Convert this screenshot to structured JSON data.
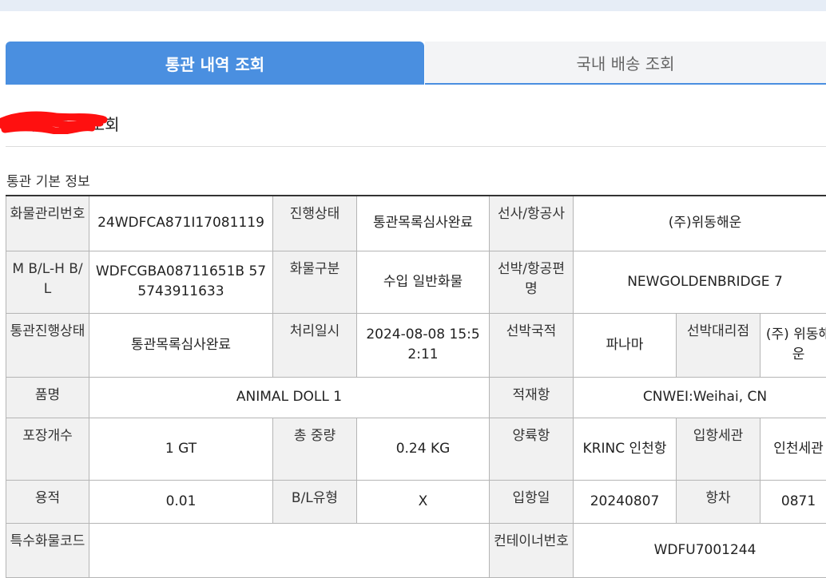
{
  "tabs": {
    "active": "통관 내역 조회",
    "inactive": "국내 배송 조회"
  },
  "title": {
    "name": "고객님",
    "suffix": " 통관 조회"
  },
  "section_title": "통관 기본 정보",
  "table": {
    "r1": {
      "h1": "화물관리번호",
      "v1": "24WDFCA871I17081119",
      "h2": "진행상태",
      "v2": "통관목록심사완료",
      "h3": "선사/항공사",
      "v3": "(주)위동해운"
    },
    "r2": {
      "h1": "M B/L-H B/L",
      "v1": "WDFCGBA08711651B 575743911633",
      "h2": "화물구분",
      "v2": "수입 일반화물",
      "h3": "선박/항공편명",
      "v3": "NEWGOLDENBRIDGE 7"
    },
    "r3": {
      "h1": "통관진행상태",
      "v1": "통관목록심사완료",
      "h2": "처리일시",
      "v2": "2024-08-08 15:52:11",
      "h3": "선박국적",
      "v3": "파나마",
      "h4": "선박대리점",
      "v4": "(주) 위동해운"
    },
    "r4": {
      "h1": "품명",
      "v1": "ANIMAL DOLL 1",
      "h2": "적재항",
      "v2": "CNWEI:Weihai, CN"
    },
    "r5": {
      "h1": "포장개수",
      "v1": "1 GT",
      "h2": "총 중량",
      "v2": "0.24 KG",
      "h3": "양륙항",
      "v3": "KRINC 인천항",
      "h4": "입항세관",
      "v4": "인천세관"
    },
    "r6": {
      "h1": "용적",
      "v1": "0.01",
      "h2": "B/L유형",
      "v2": "X",
      "h3": "입항일",
      "v3": "20240807",
      "h4": "항차",
      "v4": "0871"
    },
    "r7": {
      "h1": "특수화물코드",
      "v1": "",
      "h2": "컨테이너번호",
      "v2": "WDFU7001244"
    }
  }
}
